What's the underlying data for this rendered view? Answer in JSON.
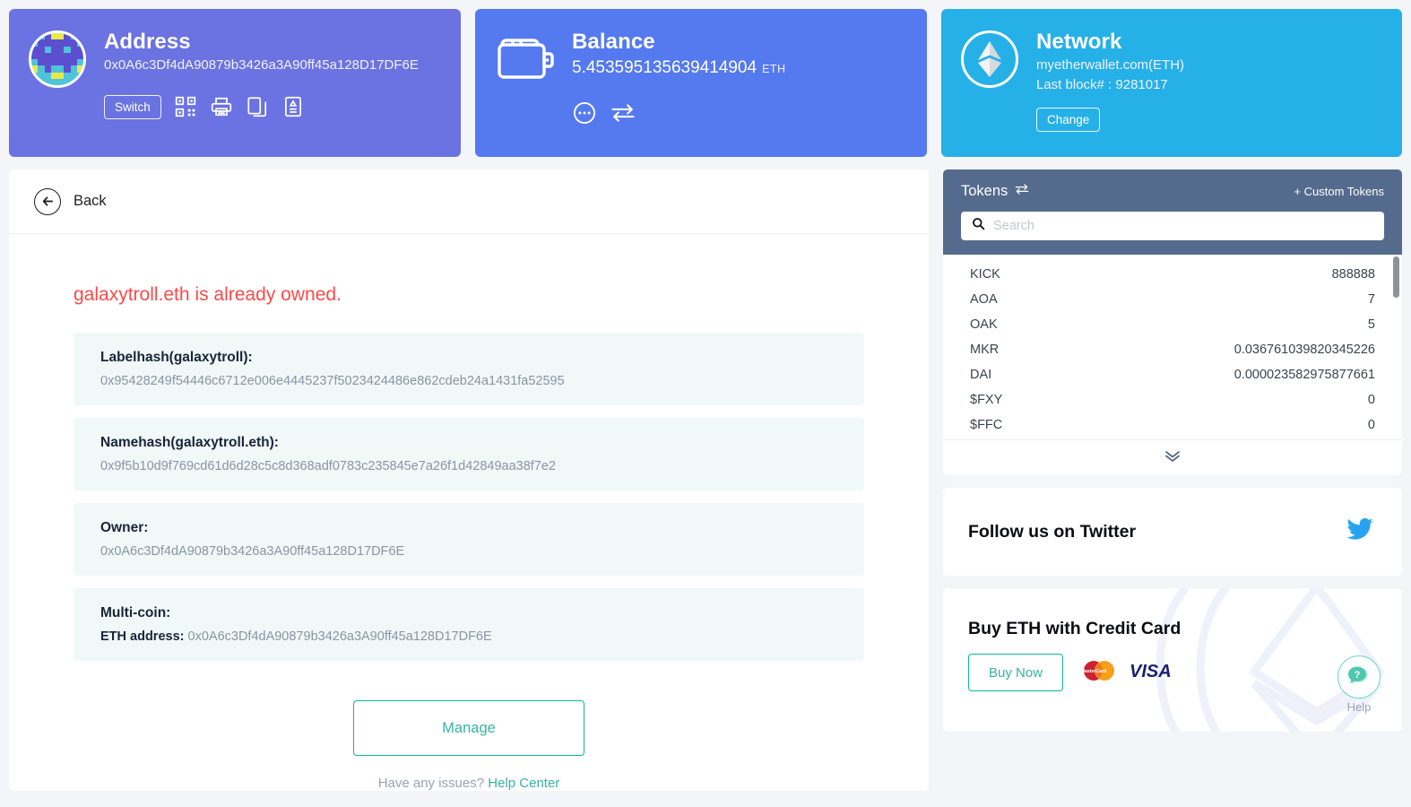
{
  "address_card": {
    "title": "Address",
    "value": "0x0A6c3Df4dA90879b3426a3A90ff45a128D17DF6E",
    "switch_label": "Switch",
    "icons": [
      "qr-code-icon",
      "print-icon",
      "copy-icon",
      "note-icon"
    ]
  },
  "balance_card": {
    "title": "Balance",
    "amount": "5.453595135639414904",
    "unit": "ETH",
    "icons": [
      "more-options-icon",
      "swap-icon"
    ]
  },
  "network_card": {
    "title": "Network",
    "provider": "myetherwallet.com(ETH)",
    "last_block": "Last block# : 9281017",
    "change_label": "Change"
  },
  "main": {
    "back_label": "Back",
    "error_message": "galaxytroll.eth is already owned.",
    "fields": [
      {
        "label": "Labelhash(galaxytroll):",
        "value": "0x95428249f54446c6712e006e4445237f5023424486e862cdeb24a1431fa52595"
      },
      {
        "label": "Namehash(galaxytroll.eth):",
        "value": "0x9f5b10d9f769cd61d6d28c5c8d368adf0783c235845e7a26f1d42849aa38f7e2"
      },
      {
        "label": "Owner:",
        "value": "0x0A6c3Df4dA90879b3426a3A90ff45a128D17DF6E"
      }
    ],
    "multicoin": {
      "label": "Multi-coin:",
      "eth_label": "ETH address:",
      "eth_value": "0x0A6c3Df4dA90879b3426a3A90ff45a128D17DF6E"
    },
    "manage_label": "Manage",
    "issues_text": "Have any issues?",
    "help_center_label": "Help Center"
  },
  "tokens": {
    "title": "Tokens",
    "custom_tokens_label": "+ Custom Tokens",
    "search_placeholder": "Search",
    "search_value": "",
    "rows": [
      {
        "symbol": "KICK",
        "value": "888888"
      },
      {
        "symbol": "AOA",
        "value": "7"
      },
      {
        "symbol": "OAK",
        "value": "5"
      },
      {
        "symbol": "MKR",
        "value": "0.036761039820345226"
      },
      {
        "symbol": "DAI",
        "value": "0.000023582975877661"
      },
      {
        "symbol": "$FXY",
        "value": "0"
      },
      {
        "symbol": "$FFC",
        "value": "0"
      }
    ],
    "expand_icon": "double-chevron-down-icon"
  },
  "twitter": {
    "title": "Follow us on Twitter",
    "icon": "twitter-bird-icon"
  },
  "buy": {
    "title": "Buy ETH with Credit Card",
    "button_label": "Buy Now",
    "card_logos": [
      "MasterCard",
      "VISA"
    ]
  },
  "help": {
    "label": "Help",
    "icon": "question-chat-icon"
  },
  "colors": {
    "address_card": "#6b72e1",
    "balance_card": "#5579ef",
    "network_card": "#26b0e8",
    "tokens_header": "#556b8d",
    "error_text": "#fc4949",
    "accent_teal": "#35b4a2",
    "twitter_blue": "#29a3f0"
  }
}
